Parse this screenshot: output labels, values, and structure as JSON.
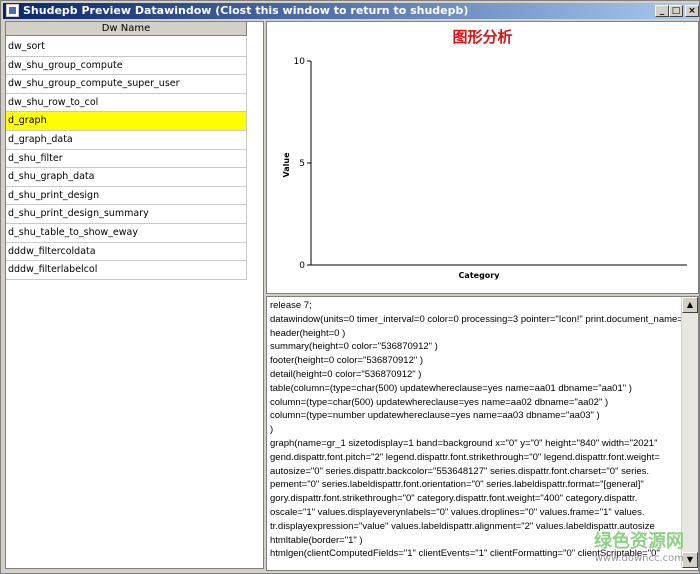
{
  "window": {
    "title": "Shudepb Preview Datawindow (Clost this window to return to shudepb)",
    "buttons": {
      "minimize": "_",
      "maximize": "□",
      "close": "×"
    }
  },
  "list": {
    "header": "Dw Name",
    "selected_index": 4,
    "items": [
      "dw_sort",
      "dw_shu_group_compute",
      "dw_shu_group_compute_super_user",
      "dw_shu_row_to_col",
      "d_graph",
      "d_graph_data",
      "d_shu_filter",
      "d_shu_graph_data",
      "d_shu_print_design",
      "d_shu_print_design_summary",
      "d_shu_table_to_show_eway",
      "dddw_filtercoldata",
      "dddw_filterlabelcol"
    ]
  },
  "chart_data": {
    "type": "bar",
    "title": "图形分析",
    "xlabel": "Category",
    "ylabel": "Value",
    "ylim": [
      0,
      10
    ],
    "yticks": [
      "10",
      "5",
      "0"
    ],
    "categories": [],
    "values": []
  },
  "code": {
    "lines": [
      "release 7;",
      "datawindow(units=0 timer_interval=0 color=0 processing=3 pointer=\"Icon!\"  print.document_name=",
      "header(height=0 )",
      "summary(height=0 color=\"536870912\" )",
      "footer(height=0 color=\"536870912\" )",
      "detail(height=0 color=\"536870912\" )",
      "table(column=(type=char(500) updatewhereclause=yes name=aa01 dbname=\"aa01\"  )",
      "column=(type=char(500) updatewhereclause=yes name=aa02 dbname=\"aa02\"  )",
      "column=(type=number updatewhereclause=yes name=aa03 dbname=\"aa03\"  )",
      ")",
      "graph(name=gr_1 sizetodisplay=1 band=background x=\"0\" y=\"0\" height=\"840\" width=\"2021\"",
      "gend.dispattr.font.pitch=\"2\" legend.dispattr.font.strikethrough=\"0\" legend.dispattr.font.weight=",
      "autosize=\"0\" series.dispattr.backcolor=\"553648127\" series.dispattr.font.charset=\"0\" series.",
      "pement=\"0\" series.labeldispattr.font.orientation=\"0\" series.labeldispattr.format=\"[general]\"",
      "gory.dispattr.font.strikethrough=\"0\" category.dispattr.font.weight=\"400\" category.dispattr.",
      "oscale=\"1\" values.displayeverynlabels=\"0\" values.droplines=\"0\" values.frame=\"1\" values.",
      "tr.displayexpression=\"value\" values.labeldispattr.alignment=\"2\" values.labeldispattr.autosize",
      "htmltable(border=\"1\" )",
      "htmlgen(clientComputedFields=\"1\" clientEvents=\"1\" clientFormatting=\"0\" clientScriptable=\"0\""
    ]
  },
  "watermark": {
    "text": "绿色资源网",
    "url": "www.downcc.com"
  }
}
